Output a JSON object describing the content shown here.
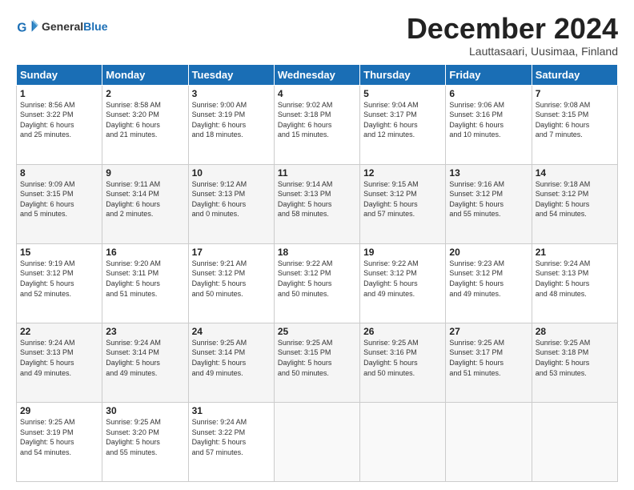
{
  "header": {
    "logo_general": "General",
    "logo_blue": "Blue",
    "month": "December 2024",
    "location": "Lauttasaari, Uusimaa, Finland"
  },
  "weekdays": [
    "Sunday",
    "Monday",
    "Tuesday",
    "Wednesday",
    "Thursday",
    "Friday",
    "Saturday"
  ],
  "weeks": [
    [
      {
        "day": "1",
        "info": "Sunrise: 8:56 AM\nSunset: 3:22 PM\nDaylight: 6 hours\nand 25 minutes."
      },
      {
        "day": "2",
        "info": "Sunrise: 8:58 AM\nSunset: 3:20 PM\nDaylight: 6 hours\nand 21 minutes."
      },
      {
        "day": "3",
        "info": "Sunrise: 9:00 AM\nSunset: 3:19 PM\nDaylight: 6 hours\nand 18 minutes."
      },
      {
        "day": "4",
        "info": "Sunrise: 9:02 AM\nSunset: 3:18 PM\nDaylight: 6 hours\nand 15 minutes."
      },
      {
        "day": "5",
        "info": "Sunrise: 9:04 AM\nSunset: 3:17 PM\nDaylight: 6 hours\nand 12 minutes."
      },
      {
        "day": "6",
        "info": "Sunrise: 9:06 AM\nSunset: 3:16 PM\nDaylight: 6 hours\nand 10 minutes."
      },
      {
        "day": "7",
        "info": "Sunrise: 9:08 AM\nSunset: 3:15 PM\nDaylight: 6 hours\nand 7 minutes."
      }
    ],
    [
      {
        "day": "8",
        "info": "Sunrise: 9:09 AM\nSunset: 3:15 PM\nDaylight: 6 hours\nand 5 minutes."
      },
      {
        "day": "9",
        "info": "Sunrise: 9:11 AM\nSunset: 3:14 PM\nDaylight: 6 hours\nand 2 minutes."
      },
      {
        "day": "10",
        "info": "Sunrise: 9:12 AM\nSunset: 3:13 PM\nDaylight: 6 hours\nand 0 minutes."
      },
      {
        "day": "11",
        "info": "Sunrise: 9:14 AM\nSunset: 3:13 PM\nDaylight: 5 hours\nand 58 minutes."
      },
      {
        "day": "12",
        "info": "Sunrise: 9:15 AM\nSunset: 3:12 PM\nDaylight: 5 hours\nand 57 minutes."
      },
      {
        "day": "13",
        "info": "Sunrise: 9:16 AM\nSunset: 3:12 PM\nDaylight: 5 hours\nand 55 minutes."
      },
      {
        "day": "14",
        "info": "Sunrise: 9:18 AM\nSunset: 3:12 PM\nDaylight: 5 hours\nand 54 minutes."
      }
    ],
    [
      {
        "day": "15",
        "info": "Sunrise: 9:19 AM\nSunset: 3:12 PM\nDaylight: 5 hours\nand 52 minutes."
      },
      {
        "day": "16",
        "info": "Sunrise: 9:20 AM\nSunset: 3:11 PM\nDaylight: 5 hours\nand 51 minutes."
      },
      {
        "day": "17",
        "info": "Sunrise: 9:21 AM\nSunset: 3:12 PM\nDaylight: 5 hours\nand 50 minutes."
      },
      {
        "day": "18",
        "info": "Sunrise: 9:22 AM\nSunset: 3:12 PM\nDaylight: 5 hours\nand 50 minutes."
      },
      {
        "day": "19",
        "info": "Sunrise: 9:22 AM\nSunset: 3:12 PM\nDaylight: 5 hours\nand 49 minutes."
      },
      {
        "day": "20",
        "info": "Sunrise: 9:23 AM\nSunset: 3:12 PM\nDaylight: 5 hours\nand 49 minutes."
      },
      {
        "day": "21",
        "info": "Sunrise: 9:24 AM\nSunset: 3:13 PM\nDaylight: 5 hours\nand 48 minutes."
      }
    ],
    [
      {
        "day": "22",
        "info": "Sunrise: 9:24 AM\nSunset: 3:13 PM\nDaylight: 5 hours\nand 49 minutes."
      },
      {
        "day": "23",
        "info": "Sunrise: 9:24 AM\nSunset: 3:14 PM\nDaylight: 5 hours\nand 49 minutes."
      },
      {
        "day": "24",
        "info": "Sunrise: 9:25 AM\nSunset: 3:14 PM\nDaylight: 5 hours\nand 49 minutes."
      },
      {
        "day": "25",
        "info": "Sunrise: 9:25 AM\nSunset: 3:15 PM\nDaylight: 5 hours\nand 50 minutes."
      },
      {
        "day": "26",
        "info": "Sunrise: 9:25 AM\nSunset: 3:16 PM\nDaylight: 5 hours\nand 50 minutes."
      },
      {
        "day": "27",
        "info": "Sunrise: 9:25 AM\nSunset: 3:17 PM\nDaylight: 5 hours\nand 51 minutes."
      },
      {
        "day": "28",
        "info": "Sunrise: 9:25 AM\nSunset: 3:18 PM\nDaylight: 5 hours\nand 53 minutes."
      }
    ],
    [
      {
        "day": "29",
        "info": "Sunrise: 9:25 AM\nSunset: 3:19 PM\nDaylight: 5 hours\nand 54 minutes."
      },
      {
        "day": "30",
        "info": "Sunrise: 9:25 AM\nSunset: 3:20 PM\nDaylight: 5 hours\nand 55 minutes."
      },
      {
        "day": "31",
        "info": "Sunrise: 9:24 AM\nSunset: 3:22 PM\nDaylight: 5 hours\nand 57 minutes."
      },
      {
        "day": "",
        "info": ""
      },
      {
        "day": "",
        "info": ""
      },
      {
        "day": "",
        "info": ""
      },
      {
        "day": "",
        "info": ""
      }
    ]
  ]
}
